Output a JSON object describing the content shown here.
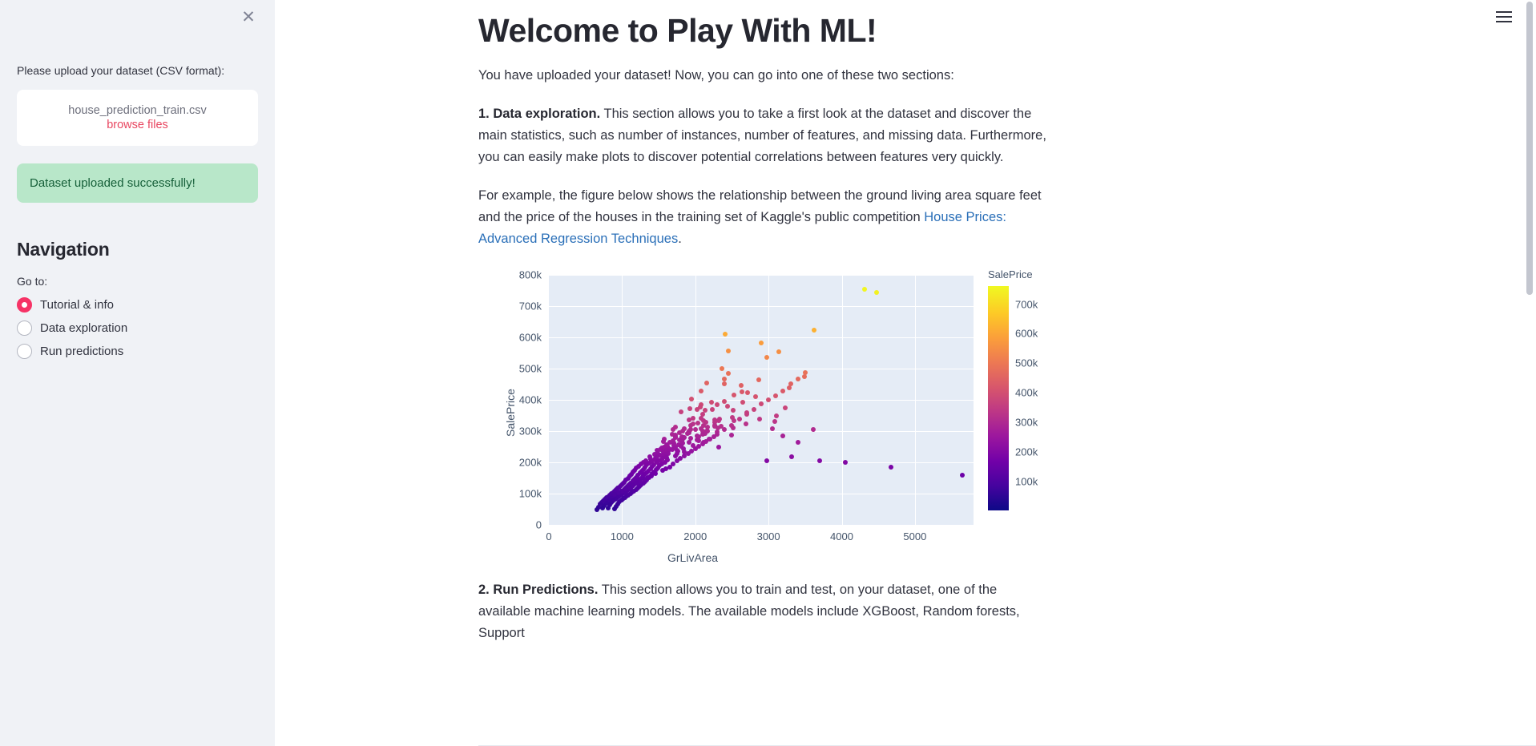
{
  "sidebar": {
    "close_icon": "close-icon",
    "uploader": {
      "label": "Please upload your dataset (CSV format):",
      "filename": "house_prediction_train.csv",
      "browse_label": "browse files"
    },
    "success_message": "Dataset uploaded successfully!",
    "nav_title": "Navigation",
    "goto_label": "Go to:",
    "radio_options": [
      {
        "label": "Tutorial & info",
        "selected": true
      },
      {
        "label": "Data exploration",
        "selected": false
      },
      {
        "label": "Run predictions",
        "selected": false
      }
    ],
    "accent_color": "#f63366",
    "background_color": "#f0f2f6",
    "success_bg": "#b8e7c9",
    "success_fg": "#17603a"
  },
  "header": {
    "menu_icon": "hamburger-menu-icon",
    "title": "Welcome to Play With ML!"
  },
  "main": {
    "intro": "You have uploaded your dataset! Now, you can go into one of these two sections:",
    "section1_lead": "1. Data exploration.",
    "section1_body": " This section allows you to take a first look at the dataset and discover the main statistics, such as number of instances, number of features, and missing data. Furthermore, you can easily make plots to discover potential correlations between features very quickly.",
    "example_pre": "For example, the figure below shows the relationship between the ground living area square feet and the price of the houses in the training set of Kaggle's public competition ",
    "example_link": "House Prices: Advanced Regression Techniques",
    "example_post": ".",
    "section2_lead": "2. Run Predictions.",
    "section2_body": " This section allows you to train and test, on your dataset, one of the available machine learning models. The available models include XGBoost, Random forests, Support",
    "link_color": "#2a6fb8"
  },
  "chart_data": {
    "type": "scatter",
    "title": "",
    "xlabel": "GrLivArea",
    "ylabel": "SalePrice",
    "xlim": [
      0,
      5800
    ],
    "ylim": [
      0,
      800000
    ],
    "xticks": [
      "0",
      "1000",
      "2000",
      "3000",
      "4000",
      "5000"
    ],
    "xtick_values": [
      0,
      1000,
      2000,
      3000,
      4000,
      5000
    ],
    "yticks": [
      "0",
      "100k",
      "200k",
      "300k",
      "400k",
      "500k",
      "600k",
      "700k",
      "800k"
    ],
    "ytick_values": [
      0,
      100000,
      200000,
      300000,
      400000,
      500000,
      600000,
      700000,
      800000
    ],
    "grid": true,
    "plot_bgcolor": "#e5ecf6",
    "colorbar": {
      "title": "SalePrice",
      "ticks": [
        "100k",
        "200k",
        "300k",
        "400k",
        "500k",
        "600k",
        "700k"
      ],
      "tick_values": [
        100000,
        200000,
        300000,
        400000,
        500000,
        600000,
        700000
      ],
      "colorscale": "plasma",
      "range": [
        0,
        760000
      ]
    },
    "color_encodes": "SalePrice",
    "points": [
      [
        4676,
        184750
      ],
      [
        5642,
        160000
      ],
      [
        4476,
        745000
      ],
      [
        4316,
        755000
      ],
      [
        3627,
        625000
      ],
      [
        2411,
        611657
      ],
      [
        2898,
        582933
      ],
      [
        2452,
        556581
      ],
      [
        2978,
        538000
      ],
      [
        3138,
        556000
      ],
      [
        2364,
        501837
      ],
      [
        2446,
        485000
      ],
      [
        3493,
        475000
      ],
      [
        2872,
        465000
      ],
      [
        2392,
        466500
      ],
      [
        2156,
        455000
      ],
      [
        2402,
        451950
      ],
      [
        2630,
        446261
      ],
      [
        3279,
        438780
      ],
      [
        2080,
        430000
      ],
      [
        2633,
        426000
      ],
      [
        2714,
        423000
      ],
      [
        2524,
        415298
      ],
      [
        2828,
        412500
      ],
      [
        1950,
        402861
      ],
      [
        2392,
        395192
      ],
      [
        2646,
        394432
      ],
      [
        2217,
        392500
      ],
      [
        2078,
        386250
      ],
      [
        2296,
        385000
      ],
      [
        2444,
        381000
      ],
      [
        2066,
        377426
      ],
      [
        3228,
        375000
      ],
      [
        1928,
        372500
      ],
      [
        2234,
        370878
      ],
      [
        2020,
        369900
      ],
      [
        2132,
        368000
      ],
      [
        2514,
        367294
      ],
      [
        1810,
        361919
      ],
      [
        2706,
        359100
      ],
      [
        2096,
        355000
      ],
      [
        3112,
        350000
      ],
      [
        2504,
        345000
      ],
      [
        1966,
        342643
      ],
      [
        2080,
        341000
      ],
      [
        2336,
        340000
      ],
      [
        2270,
        337500
      ],
      [
        1920,
        336000
      ],
      [
        2524,
        335000
      ],
      [
        2112,
        334000
      ],
      [
        2324,
        333168
      ],
      [
        3086,
        332000
      ],
      [
        2270,
        330000
      ],
      [
        2144,
        328900
      ],
      [
        2032,
        325624
      ],
      [
        1968,
        325000
      ],
      [
        2692,
        324000
      ],
      [
        2110,
        320000
      ],
      [
        2270,
        319900
      ],
      [
        2262,
        319000
      ],
      [
        1936,
        318000
      ],
      [
        2358,
        317000
      ],
      [
        2270,
        315500
      ],
      [
        2166,
        315000
      ],
      [
        1734,
        313000
      ],
      [
        2314,
        312500
      ],
      [
        2516,
        311500
      ],
      [
        2078,
        310000
      ],
      [
        1852,
        309000
      ],
      [
        1934,
        307000
      ],
      [
        3608,
        306000
      ],
      [
        1998,
        305900
      ],
      [
        1700,
        305000
      ],
      [
        2160,
        302000
      ],
      [
        2164,
        301500
      ],
      [
        1916,
        301000
      ],
      [
        2096,
        300000
      ],
      [
        1824,
        299800
      ],
      [
        2296,
        299000
      ],
      [
        1788,
        297000
      ],
      [
        1918,
        295493
      ],
      [
        2134,
        294000
      ],
      [
        1888,
        293000
      ],
      [
        2102,
        291000
      ],
      [
        1684,
        290000
      ],
      [
        2492,
        289000
      ],
      [
        1730,
        287000
      ],
      [
        2022,
        285000
      ],
      [
        1734,
        284000
      ],
      [
        2050,
        283463
      ],
      [
        1812,
        282922
      ],
      [
        1730,
        280000
      ],
      [
        1848,
        279500
      ],
      [
        1934,
        277500
      ],
      [
        1574,
        275000
      ],
      [
        2186,
        274970
      ],
      [
        1826,
        274725
      ],
      [
        2028,
        274000
      ],
      [
        1786,
        272000
      ],
      [
        2042,
        271000
      ],
      [
        1694,
        269790
      ],
      [
        1816,
        268000
      ],
      [
        1570,
        266500
      ],
      [
        2116,
        265979
      ],
      [
        1654,
        265000
      ],
      [
        1920,
        264561
      ],
      [
        1830,
        263435
      ],
      [
        1702,
        262500
      ],
      [
        1812,
        260000
      ],
      [
        1708,
        259500
      ],
      [
        1772,
        257500
      ],
      [
        1604,
        256300
      ],
      [
        1710,
        255500
      ],
      [
        1972,
        255000
      ],
      [
        1616,
        253293
      ],
      [
        1804,
        252678
      ],
      [
        2324,
        250580
      ],
      [
        1578,
        250000
      ],
      [
        1734,
        248900
      ],
      [
        1548,
        247000
      ],
      [
        1702,
        246578
      ],
      [
        1834,
        245500
      ],
      [
        1642,
        244000
      ],
      [
        1520,
        243000
      ],
      [
        1684,
        241500
      ],
      [
        1746,
        240000
      ],
      [
        1600,
        239799
      ],
      [
        1478,
        239000
      ],
      [
        1764,
        237500
      ],
      [
        1628,
        236500
      ],
      [
        1854,
        235000
      ],
      [
        1560,
        233230
      ],
      [
        1616,
        232600
      ],
      [
        1746,
        230000
      ],
      [
        1488,
        229456
      ],
      [
        1634,
        228500
      ],
      [
        1602,
        227000
      ],
      [
        1442,
        226000
      ],
      [
        1556,
        224900
      ],
      [
        1516,
        223500
      ],
      [
        1726,
        222000
      ],
      [
        1380,
        220000
      ],
      [
        1596,
        219500
      ],
      [
        1476,
        218000
      ],
      [
        1612,
        216500
      ],
      [
        1452,
        215000
      ],
      [
        1554,
        213500
      ],
      [
        1388,
        212000
      ],
      [
        1528,
        210000
      ],
      [
        1444,
        208900
      ],
      [
        1616,
        207500
      ],
      [
        1322,
        206300
      ],
      [
        1502,
        205000
      ],
      [
        1404,
        203000
      ],
      [
        1586,
        201000
      ],
      [
        1290,
        200000
      ],
      [
        1480,
        199900
      ],
      [
        1366,
        198500
      ],
      [
        1542,
        197000
      ],
      [
        1258,
        195400
      ],
      [
        1438,
        194000
      ],
      [
        1340,
        192500
      ],
      [
        1510,
        190000
      ],
      [
        1226,
        189000
      ],
      [
        1412,
        187500
      ],
      [
        1318,
        186000
      ],
      [
        1488,
        184000
      ],
      [
        1198,
        182000
      ],
      [
        1386,
        180500
      ],
      [
        1292,
        179000
      ],
      [
        1462,
        177500
      ],
      [
        1176,
        176000
      ],
      [
        1358,
        174000
      ],
      [
        1268,
        172500
      ],
      [
        1438,
        171000
      ],
      [
        1148,
        169500
      ],
      [
        1330,
        168000
      ],
      [
        1244,
        166500
      ],
      [
        1412,
        165000
      ],
      [
        1126,
        163000
      ],
      [
        1302,
        161500
      ],
      [
        1218,
        160000
      ],
      [
        1390,
        158500
      ],
      [
        1100,
        157000
      ],
      [
        1278,
        155000
      ],
      [
        1196,
        153500
      ],
      [
        1364,
        152000
      ],
      [
        1078,
        150000
      ],
      [
        1250,
        148500
      ],
      [
        1170,
        147000
      ],
      [
        1338,
        145500
      ],
      [
        1052,
        144000
      ],
      [
        1226,
        142500
      ],
      [
        1146,
        141000
      ],
      [
        1312,
        139500
      ],
      [
        1030,
        138000
      ],
      [
        1200,
        136500
      ],
      [
        1120,
        135000
      ],
      [
        1288,
        134000
      ],
      [
        1008,
        132500
      ],
      [
        1176,
        131000
      ],
      [
        1096,
        130000
      ],
      [
        1262,
        129000
      ],
      [
        986,
        127500
      ],
      [
        1150,
        126000
      ],
      [
        1072,
        125000
      ],
      [
        1238,
        124000
      ],
      [
        962,
        122500
      ],
      [
        1126,
        121000
      ],
      [
        1048,
        120000
      ],
      [
        1212,
        119000
      ],
      [
        940,
        118000
      ],
      [
        1100,
        116500
      ],
      [
        1024,
        115000
      ],
      [
        1188,
        114000
      ],
      [
        918,
        113000
      ],
      [
        1076,
        112000
      ],
      [
        1000,
        110000
      ],
      [
        1162,
        109500
      ],
      [
        896,
        108000
      ],
      [
        1050,
        107000
      ],
      [
        976,
        106000
      ],
      [
        1138,
        105000
      ],
      [
        872,
        104000
      ],
      [
        1026,
        103000
      ],
      [
        952,
        102000
      ],
      [
        1112,
        101000
      ],
      [
        850,
        100000
      ],
      [
        1000,
        99000
      ],
      [
        928,
        98000
      ],
      [
        1088,
        97000
      ],
      [
        828,
        96000
      ],
      [
        976,
        95000
      ],
      [
        904,
        94000
      ],
      [
        1064,
        93000
      ],
      [
        806,
        92000
      ],
      [
        952,
        91000
      ],
      [
        880,
        90000
      ],
      [
        1040,
        89000
      ],
      [
        784,
        88000
      ],
      [
        928,
        87000
      ],
      [
        856,
        86000
      ],
      [
        1016,
        85000
      ],
      [
        762,
        84000
      ],
      [
        904,
        82500
      ],
      [
        832,
        81000
      ],
      [
        992,
        80000
      ],
      [
        740,
        79000
      ],
      [
        880,
        78000
      ],
      [
        808,
        76500
      ],
      [
        968,
        75000
      ],
      [
        718,
        73500
      ],
      [
        856,
        72000
      ],
      [
        784,
        70000
      ],
      [
        944,
        68000
      ],
      [
        696,
        66500
      ],
      [
        832,
        64500
      ],
      [
        760,
        62500
      ],
      [
        920,
        60500
      ],
      [
        674,
        58500
      ],
      [
        808,
        56000
      ],
      [
        736,
        54000
      ],
      [
        896,
        52000
      ],
      [
        652,
        50000
      ],
      [
        1600,
        180000
      ],
      [
        1550,
        175000
      ],
      [
        1700,
        195000
      ],
      [
        1650,
        185000
      ],
      [
        1800,
        215000
      ],
      [
        1750,
        205000
      ],
      [
        1900,
        230000
      ],
      [
        1850,
        222000
      ],
      [
        2000,
        245000
      ],
      [
        1950,
        238000
      ],
      [
        2100,
        260000
      ],
      [
        2050,
        252000
      ],
      [
        2200,
        275000
      ],
      [
        2150,
        268000
      ],
      [
        2300,
        290000
      ],
      [
        2250,
        282000
      ],
      [
        1450,
        165000
      ],
      [
        1400,
        158000
      ],
      [
        1350,
        152000
      ],
      [
        1300,
        146000
      ],
      [
        1250,
        140000
      ],
      [
        1200,
        134000
      ],
      [
        1150,
        128000
      ],
      [
        1100,
        122000
      ],
      [
        1050,
        116000
      ],
      [
        1000,
        110000
      ],
      [
        950,
        104000
      ],
      [
        900,
        98000
      ],
      [
        2500,
        320000
      ],
      [
        2400,
        305000
      ],
      [
        2600,
        340000
      ],
      [
        2700,
        355000
      ],
      [
        2800,
        370000
      ],
      [
        2900,
        388000
      ],
      [
        3000,
        400000
      ],
      [
        3100,
        415000
      ],
      [
        3200,
        430000
      ],
      [
        3300,
        452000
      ],
      [
        3400,
        468000
      ],
      [
        3500,
        487000
      ],
      [
        2880,
        340000
      ],
      [
        3050,
        310000
      ],
      [
        3200,
        285000
      ],
      [
        3400,
        265000
      ],
      [
        3700,
        205000
      ],
      [
        4050,
        200000
      ],
      [
        2980,
        205000
      ],
      [
        3320,
        218000
      ]
    ]
  }
}
